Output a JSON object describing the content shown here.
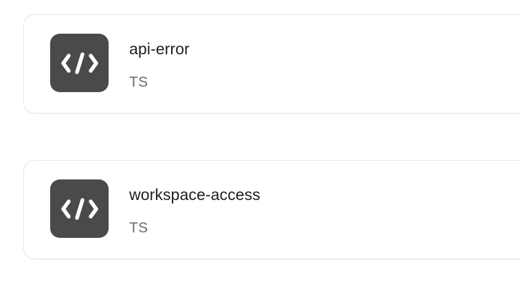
{
  "items": [
    {
      "name": "api-error",
      "language": "TS",
      "icon": "code-icon"
    },
    {
      "name": "workspace-access",
      "language": "TS",
      "icon": "code-icon"
    }
  ],
  "colors": {
    "icon_tile_bg": "#4a4a4a",
    "icon_fg": "#ffffff",
    "title_text": "#1f1f1f",
    "subtitle_text": "#6b6b6b",
    "card_border": "#e6e6e6"
  }
}
